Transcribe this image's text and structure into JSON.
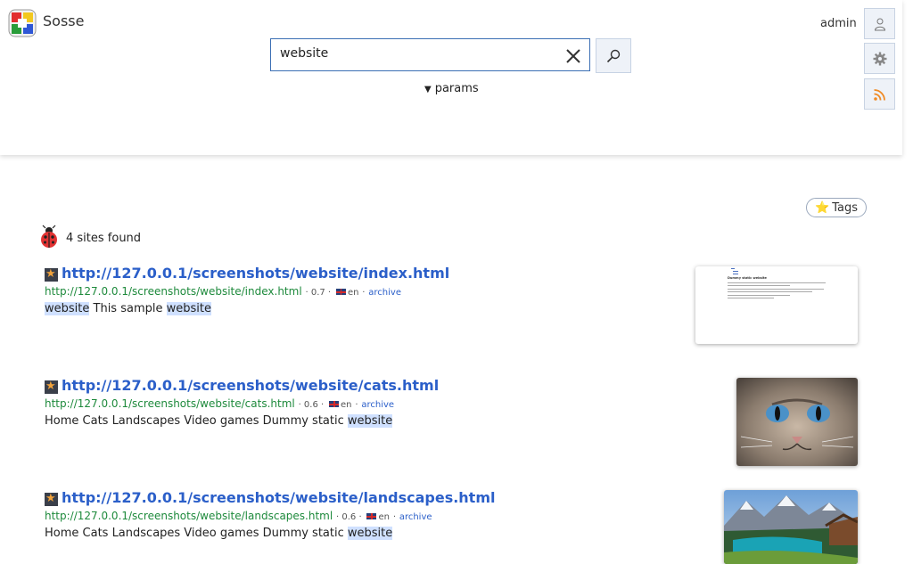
{
  "app": {
    "name": "Sosse",
    "user": "admin"
  },
  "search": {
    "query": "website",
    "params_label": "params"
  },
  "tags_button": {
    "label": "Tags"
  },
  "results_summary": {
    "count_text": "4 sites found"
  },
  "results": [
    {
      "title": "http://127.0.0.1/screenshots/website/index.html",
      "url": "http://127.0.0.1/screenshots/website/index.html",
      "score": "· 0.7 ·",
      "lang": "en",
      "archive_label": "archive",
      "snippet": [
        {
          "text": "website",
          "hl": true
        },
        {
          "text": "This sample",
          "hl": false
        },
        {
          "text": "website",
          "hl": true
        }
      ],
      "thumb_heading": "Dummy static website"
    },
    {
      "title": "http://127.0.0.1/screenshots/website/cats.html",
      "url": "http://127.0.0.1/screenshots/website/cats.html",
      "score": "· 0.6 ·",
      "lang": "en",
      "archive_label": "archive",
      "snippet": [
        {
          "text": "Home Cats Landscapes Video games Dummy static",
          "hl": false
        },
        {
          "text": "website",
          "hl": true
        }
      ]
    },
    {
      "title": "http://127.0.0.1/screenshots/website/landscapes.html",
      "url": "http://127.0.0.1/screenshots/website/landscapes.html",
      "score": "· 0.6 ·",
      "lang": "en",
      "archive_label": "archive",
      "snippet": [
        {
          "text": "Home Cats Landscapes Video games Dummy static",
          "hl": false
        },
        {
          "text": "website",
          "hl": true
        }
      ]
    }
  ],
  "colors": {
    "link": "#2b5fc9",
    "url": "#1e8a3c",
    "highlight": "#cfe0ff",
    "accent": "#3b6fb4"
  }
}
